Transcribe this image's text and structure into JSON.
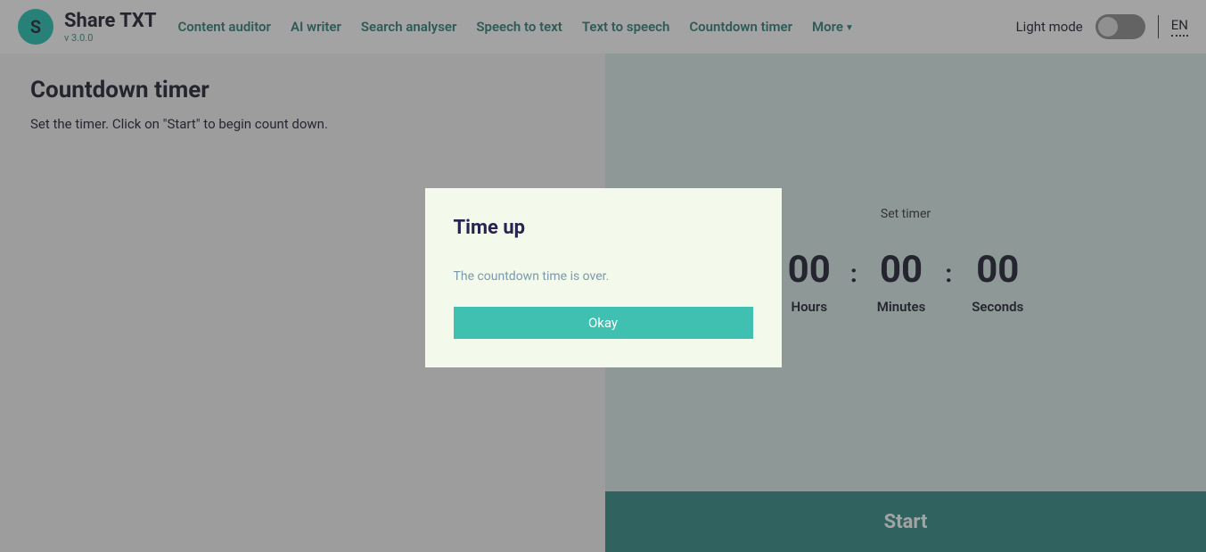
{
  "header": {
    "logo_letter": "S",
    "logo_title": "Share TXT",
    "version": "v 3.0.0",
    "nav": [
      "Content auditor",
      "AI writer",
      "Search analyser",
      "Speech to text",
      "Text to speech",
      "Countdown timer"
    ],
    "more_label": "More",
    "light_mode_label": "Light mode",
    "lang": "EN"
  },
  "page": {
    "title": "Countdown timer",
    "subtitle": "Set the timer. Click on \"Start\" to begin count down."
  },
  "timer": {
    "set_label": "Set timer",
    "hours_value": "00",
    "hours_label": "Hours",
    "minutes_value": "00",
    "minutes_label": "Minutes",
    "seconds_value": "00",
    "seconds_label": "Seconds",
    "separator": ":",
    "start_label": "Start"
  },
  "modal": {
    "title": "Time up",
    "message": "The countdown time is over.",
    "button": "Okay"
  }
}
